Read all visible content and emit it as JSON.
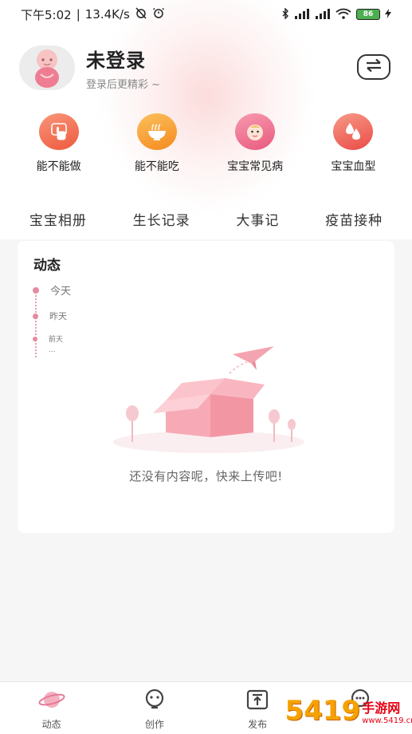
{
  "status_bar": {
    "time": "下午5:02",
    "speed": "13.4K/s",
    "battery": "86"
  },
  "profile": {
    "name": "未登录",
    "subtitle": "登录后更精彩 ~"
  },
  "tools": [
    {
      "label": "能不能做",
      "icon": "hand-pointer-icon",
      "color": "#f06b4f"
    },
    {
      "label": "能不能吃",
      "icon": "noodle-bowl-icon",
      "color": "#f59a2e"
    },
    {
      "label": "宝宝常见病",
      "icon": "baby-face-icon",
      "color": "#ee6e8c"
    },
    {
      "label": "宝宝血型",
      "icon": "blood-drops-icon",
      "color": "#ef5d52"
    }
  ],
  "categories": [
    "宝宝相册",
    "生长记录",
    "大事记",
    "疫苗接种"
  ],
  "feed": {
    "title": "动态",
    "timeline": [
      "今天",
      "昨天",
      "前天",
      "..."
    ],
    "empty_text": "还没有内容呢，快来上传吧!"
  },
  "bottom_nav": [
    {
      "label": "动态",
      "icon": "planet-icon",
      "active": true
    },
    {
      "label": "创作",
      "icon": "lightbulb-icon",
      "active": false
    },
    {
      "label": "发布",
      "icon": "upload-icon",
      "active": false
    },
    {
      "label": "",
      "icon": "chat-bubble-icon",
      "active": false
    }
  ],
  "watermark": {
    "big": "5419",
    "small": "手游网",
    "url": "www.5419.cn"
  },
  "colors": {
    "accent": "#e58aa3",
    "primary_text": "#222222"
  }
}
